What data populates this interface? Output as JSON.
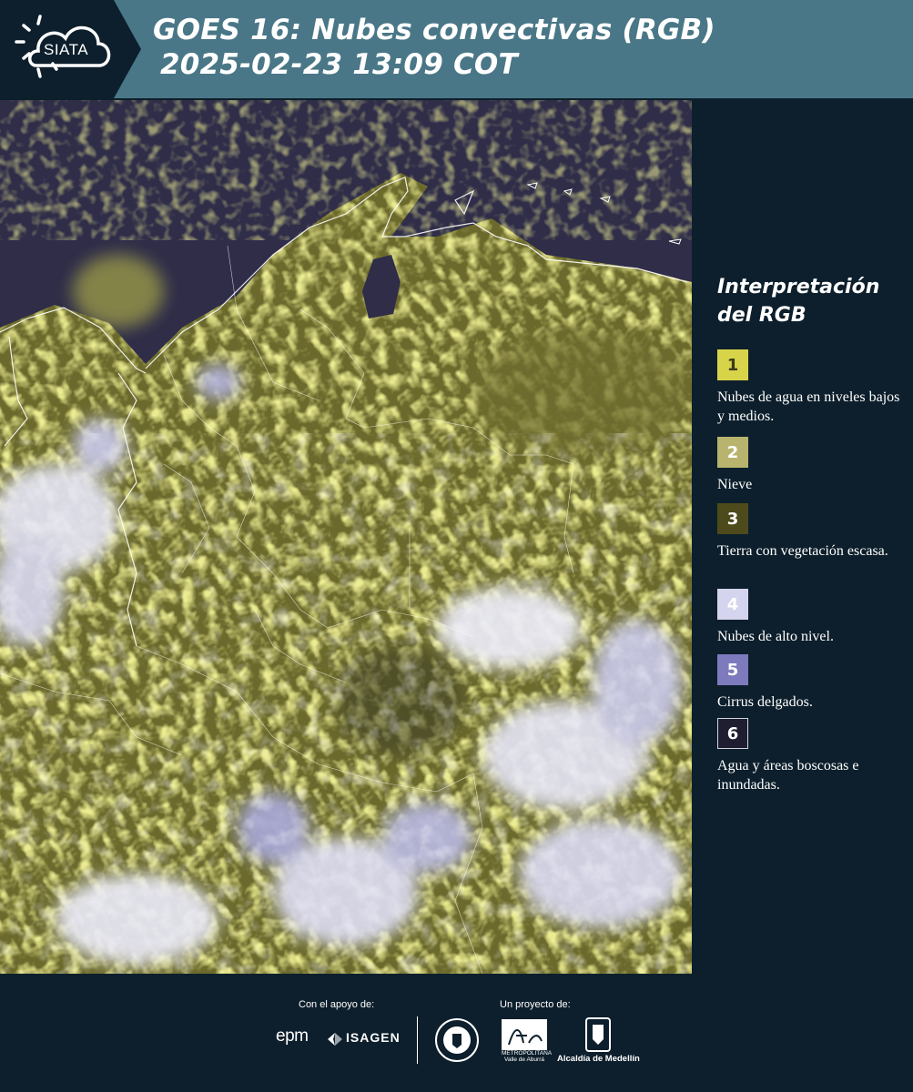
{
  "header": {
    "logo_text": "SIATA",
    "title_line1": "GOES 16: Nubes convectivas (RGB)",
    "title_line2": "2025-02-23 13:09 COT",
    "background_color": "#4a7787"
  },
  "map": {
    "description_icon": "satellite-rgb-image",
    "colors": {
      "ocean": "#2e2c47",
      "low_clouds": "#dede4a",
      "high_clouds": "#e6e6f4",
      "cirrus": "#8c8cc8",
      "borders": "#ffffff"
    }
  },
  "legend": {
    "title_line1": "Interpretación",
    "title_line2": "del RGB",
    "items": [
      {
        "number": "1",
        "label": "Nubes de agua en niveles bajos y medios.",
        "color": "#d8d44a",
        "text_color": "#3a3a1a"
      },
      {
        "number": "2",
        "label": "Nieve",
        "color": "#b8b46e",
        "text_color": "#3a3a1a"
      },
      {
        "number": "3",
        "label": "Tierra con vegetación escasa.",
        "color": "#4d4a1c",
        "text_color": "#ffffff"
      },
      {
        "number": "4",
        "label": "Nubes de alto nivel.",
        "color": "#d4d4ee",
        "text_color": "#ffffff"
      },
      {
        "number": "5",
        "label": "Cirrus delgados.",
        "color": "#7d7bbd",
        "text_color": "#ffffff"
      },
      {
        "number": "6",
        "label": "Agua y áreas boscosas e inundadas.",
        "color": "#1e1e30",
        "text_color": "#ffffff"
      }
    ]
  },
  "footer": {
    "support_label": "Con el apoyo de:",
    "project_label": "Un proyecto de:",
    "sponsor1": "epm",
    "sponsor2": "ISAGEN",
    "partner3": "Alcaldía de Medellín",
    "partner2": "METROPOLITANA Valle de Aburrá"
  }
}
